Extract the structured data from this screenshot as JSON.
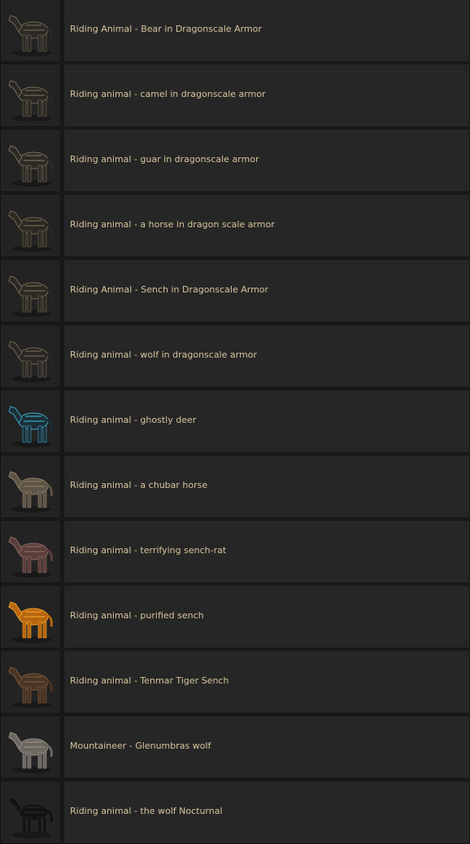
{
  "items": [
    {
      "label": "Riding Animal - Bear in Dragonscale Armor",
      "icon": "bear-armor-icon",
      "colors": {
        "body": "#2b2925",
        "accent": "#6e6552"
      }
    },
    {
      "label": "Riding animal - camel in dragonscale armor",
      "icon": "camel-armor-icon",
      "colors": {
        "body": "#2a2824",
        "accent": "#756b56"
      }
    },
    {
      "label": "Riding animal - guar in dragonscale armor",
      "icon": "guar-armor-icon",
      "colors": {
        "body": "#2d2a25",
        "accent": "#7c715a"
      }
    },
    {
      "label": "Riding animal - a horse in dragon scale armor",
      "icon": "horse-armor-icon",
      "colors": {
        "body": "#2a2723",
        "accent": "#74694f"
      }
    },
    {
      "label": "Riding Animal - Sench in Dragonscale Armor",
      "icon": "sench-armor-icon",
      "colors": {
        "body": "#2b2824",
        "accent": "#776c54"
      }
    },
    {
      "label": "Riding animal - wolf in dragonscale armor",
      "icon": "wolf-armor-icon",
      "colors": {
        "body": "#292724",
        "accent": "#6f6753"
      }
    },
    {
      "label": "Riding animal - ghostly deer",
      "icon": "ghostly-deer-icon",
      "colors": {
        "body": "#1c2f36",
        "accent": "#3fa6c8"
      }
    },
    {
      "label": "Riding animal - a chubar horse",
      "icon": "chubar-horse-icon",
      "colors": {
        "body": "#5e5445",
        "accent": "#8c7f69"
      }
    },
    {
      "label": "Riding animal - terrifying sench-rat",
      "icon": "sench-rat-icon",
      "colors": {
        "body": "#5b3e3a",
        "accent": "#8a6a63"
      }
    },
    {
      "label": "Riding animal - purified sench",
      "icon": "purified-sench-icon",
      "colors": {
        "body": "#b8650f",
        "accent": "#f0a22a"
      }
    },
    {
      "label": "Riding animal - Tenmar Tiger Sench",
      "icon": "tenmar-tiger-sench-icon",
      "colors": {
        "body": "#4a3424",
        "accent": "#7d5c3e"
      }
    },
    {
      "label": "Mountaineer - Glenumbras wolf",
      "icon": "glenumbra-wolf-icon",
      "colors": {
        "body": "#6b6660",
        "accent": "#9a948c"
      }
    },
    {
      "label": "Riding animal - the wolf Nocturnal",
      "icon": "nocturnal-wolf-icon",
      "colors": {
        "body": "#121212",
        "accent": "#2a2a2a"
      }
    }
  ]
}
